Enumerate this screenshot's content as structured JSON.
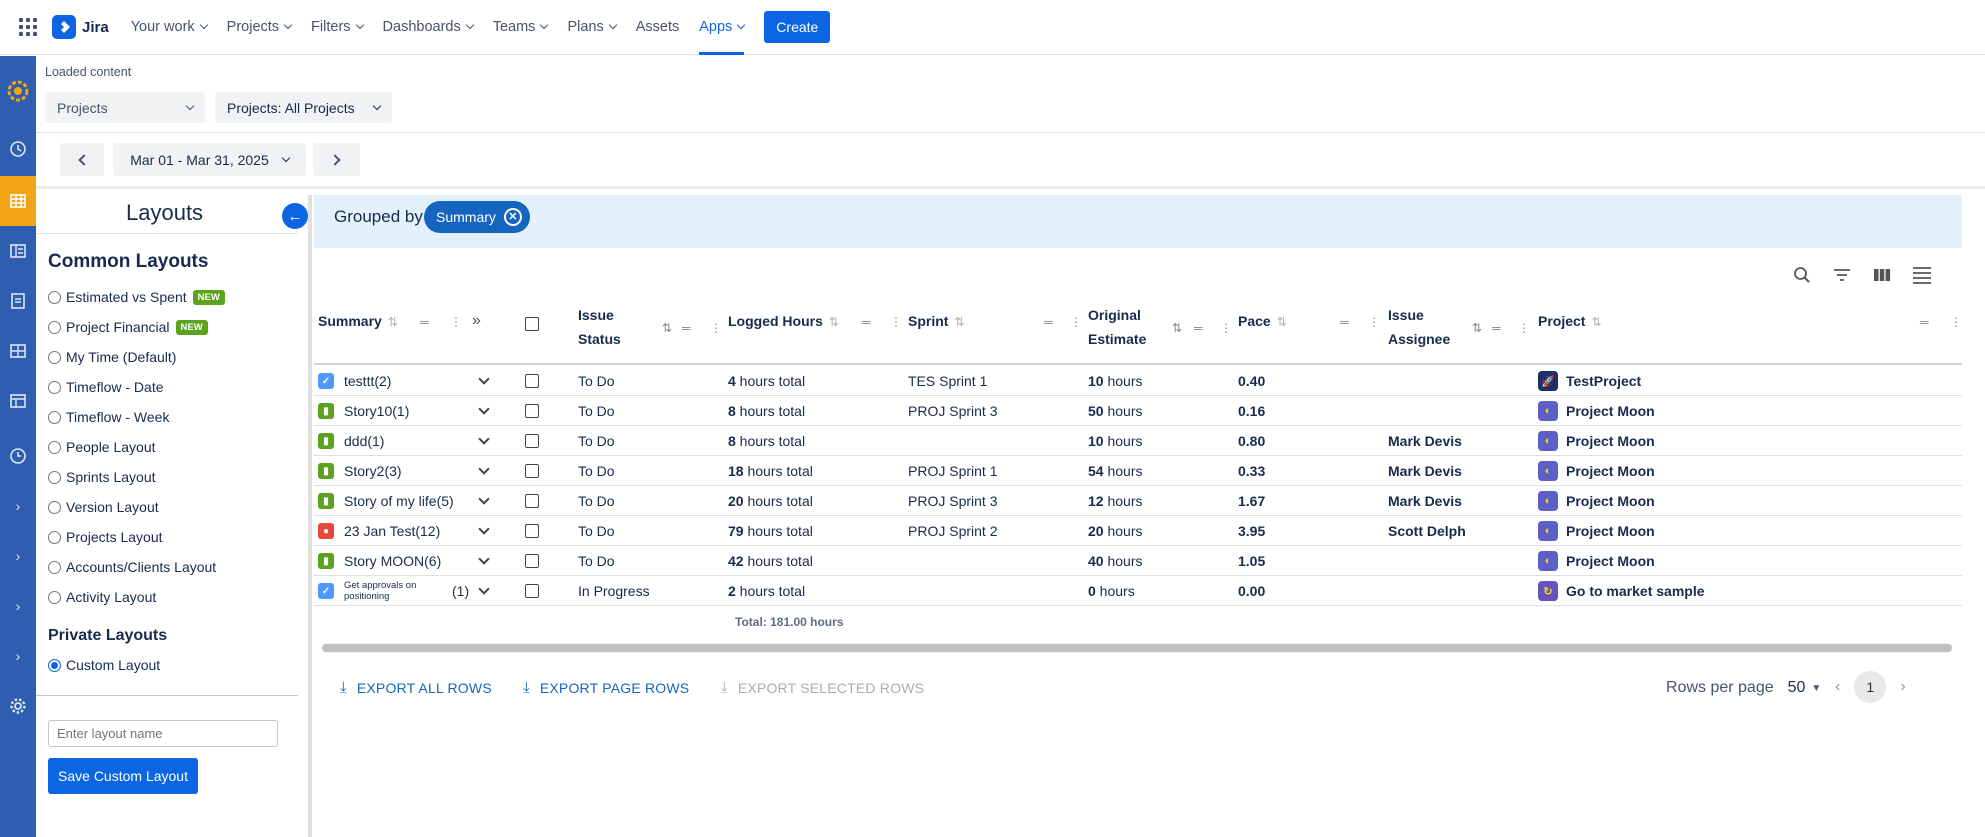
{
  "topnav": {
    "brand": "Jira",
    "items": [
      {
        "label": "Your work",
        "dropdown": true
      },
      {
        "label": "Projects",
        "dropdown": true
      },
      {
        "label": "Filters",
        "dropdown": true
      },
      {
        "label": "Dashboards",
        "dropdown": true
      },
      {
        "label": "Teams",
        "dropdown": true
      },
      {
        "label": "Plans",
        "dropdown": true
      },
      {
        "label": "Assets",
        "dropdown": false
      },
      {
        "label": "Apps",
        "dropdown": true,
        "active": true
      }
    ],
    "create_label": "Create"
  },
  "header": {
    "loaded_text": "Loaded content",
    "filter1": "Projects",
    "filter2": "Projects: All Projects",
    "date_range": "Mar 01 - Mar 31, 2025"
  },
  "layouts": {
    "title": "Layouts",
    "common_title": "Common Layouts",
    "common": [
      {
        "label": "Estimated vs Spent",
        "badge": "NEW"
      },
      {
        "label": "Project Financial",
        "badge": "NEW"
      },
      {
        "label": "My Time (Default)"
      },
      {
        "label": "Timeflow - Date"
      },
      {
        "label": "Timeflow - Week"
      },
      {
        "label": "People Layout"
      },
      {
        "label": "Sprints Layout"
      },
      {
        "label": "Version Layout"
      },
      {
        "label": "Projects Layout"
      },
      {
        "label": "Accounts/Clients Layout"
      },
      {
        "label": "Activity Layout"
      }
    ],
    "private_title": "Private Layouts",
    "private": [
      {
        "label": "Custom Layout",
        "selected": true
      }
    ],
    "input_placeholder": "Enter layout name",
    "save_label": "Save Custom Layout"
  },
  "grouping": {
    "label": "Grouped by",
    "chip": "Summary"
  },
  "table": {
    "columns": {
      "summary": "Summary",
      "status_1": "Issue",
      "status_2": "Status",
      "logged": "Logged Hours",
      "sprint": "Sprint",
      "estimate_1": "Original",
      "estimate_2": "Estimate",
      "pace": "Pace",
      "assignee_1": "Issue",
      "assignee_2": "Assignee",
      "project": "Project"
    },
    "rows": [
      {
        "type": "task",
        "summary": "testtt(2)",
        "status": "To Do",
        "logged": "4",
        "sprint": "TES Sprint 1",
        "estimate": "10",
        "pace": "0.40",
        "assignee": "",
        "project": "TestProject",
        "project_icon": "rocket"
      },
      {
        "type": "story",
        "summary": "Story10(1)",
        "status": "To Do",
        "logged": "8",
        "sprint": "PROJ Sprint 3",
        "estimate": "50",
        "pace": "0.16",
        "assignee": "",
        "project": "Project Moon",
        "project_icon": "moon"
      },
      {
        "type": "story",
        "summary": "ddd(1)",
        "status": "To Do",
        "logged": "8",
        "sprint": "",
        "estimate": "10",
        "pace": "0.80",
        "assignee": "Mark Devis",
        "project": "Project Moon",
        "project_icon": "moon"
      },
      {
        "type": "story",
        "summary": "Story2(3)",
        "status": "To Do",
        "logged": "18",
        "sprint": "PROJ Sprint 1",
        "estimate": "54",
        "pace": "0.33",
        "assignee": "Mark Devis",
        "project": "Project Moon",
        "project_icon": "moon"
      },
      {
        "type": "story",
        "summary": "Story of my life(5)",
        "status": "To Do",
        "logged": "20",
        "sprint": "PROJ Sprint 3",
        "estimate": "12",
        "pace": "1.67",
        "assignee": "Mark Devis",
        "project": "Project Moon",
        "project_icon": "moon"
      },
      {
        "type": "bug",
        "summary": "23 Jan Test(12)",
        "status": "To Do",
        "logged": "79",
        "sprint": "PROJ Sprint 2",
        "estimate": "20",
        "pace": "3.95",
        "assignee": "Scott Delph",
        "project": "Project Moon",
        "project_icon": "moon"
      },
      {
        "type": "story",
        "summary": "Story MOON(6)",
        "status": "To Do",
        "logged": "42",
        "sprint": "",
        "estimate": "40",
        "pace": "1.05",
        "assignee": "",
        "project": "Project Moon",
        "project_icon": "moon"
      },
      {
        "type": "task",
        "summary": "Get approvals on positioning",
        "count": "(1)",
        "status": "In Progress",
        "logged": "2",
        "sprint": "",
        "estimate": "0",
        "pace": "0.00",
        "assignee": "",
        "project": "Go to market sample",
        "project_icon": "market"
      }
    ],
    "logged_suffix": " hours total",
    "estimate_suffix": " hours",
    "total": "Total: 181.00 hours"
  },
  "footer": {
    "export_all": "EXPORT ALL ROWS",
    "export_page": "EXPORT PAGE ROWS",
    "export_selected": "EXPORT SELECTED ROWS",
    "rows_per_page_label": "Rows per page",
    "rows_per_page": "50",
    "page": "1"
  },
  "colors": {
    "primary": "#0c66e4",
    "rail": "#2f5db0",
    "rail_active": "#f2a514",
    "story": "#5ba31f",
    "task": "#4c9aff",
    "bug": "#e5493a",
    "group_bar": "#e3f1fb"
  }
}
